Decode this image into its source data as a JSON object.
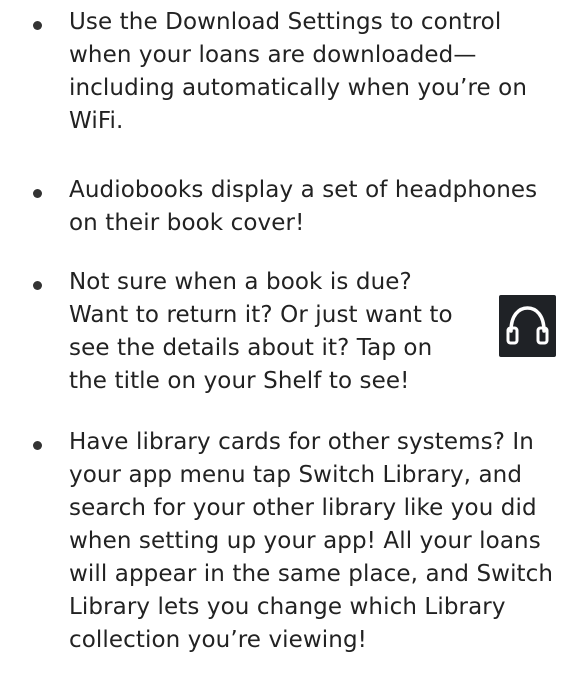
{
  "bullets": [
    {
      "lines": [
        "Use the Download Settings to control",
        "when your loans are downloaded—",
        "including automatically when you’re on",
        "WiFi."
      ]
    },
    {
      "lines": [
        "Audiobooks display a set of headphones",
        "on their book cover!"
      ]
    },
    {
      "lines": [
        "Not sure when a book is due?",
        "Want to return it?  Or just want to",
        "see the details about it?  Tap on",
        "the title on your Shelf to see!"
      ]
    },
    {
      "lines": [
        "Have library cards for other systems?  In",
        "your app menu tap Switch Library, and",
        "search for your other library like you did",
        "when setting up your app!  All your loans",
        "will appear in the same place, and Switch",
        "Library lets you change which Library",
        "collection you’re viewing!"
      ]
    }
  ],
  "icon": {
    "name": "headphones-icon",
    "background": "#1f2226",
    "stroke": "#ffffff"
  }
}
